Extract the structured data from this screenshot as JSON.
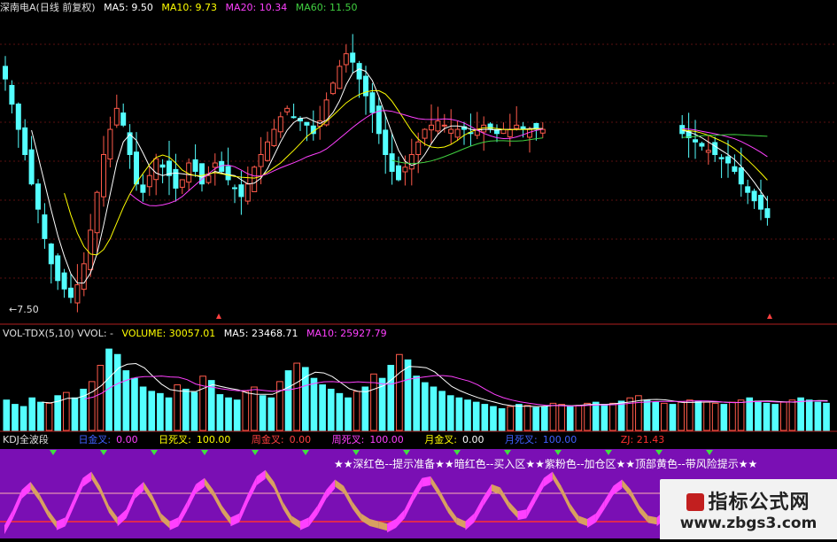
{
  "price_panel": {
    "title": "深南电A(日线 前复权)",
    "ma5": "MA5: 9.50",
    "ma10": "MA10: 9.73",
    "ma20": "MA20: 10.34",
    "ma60": "MA60: 11.50",
    "low_marker": "←7.50"
  },
  "volume_panel": {
    "title": "VOL-TDX(5,10) VVOL: -",
    "volume": "VOLUME: 30057.01",
    "ma5": "MA5: 23468.71",
    "ma10": "MA10: 25927.79"
  },
  "kdj_panel": {
    "title": "KDJ全波段",
    "items": [
      {
        "label": "日金叉:",
        "value": "0.00"
      },
      {
        "label": "日死叉:",
        "value": "100.00"
      },
      {
        "label": "周金叉:",
        "value": "0.00"
      },
      {
        "label": "周死叉:",
        "value": "100.00"
      },
      {
        "label": "月金叉:",
        "value": "0.00"
      },
      {
        "label": "月死叉:",
        "value": "100.00"
      }
    ],
    "zj": "ZJ: 21.43",
    "note": "★★深红色--提示准备★★暗红色--买入区★★紫粉色--加仓区★★顶部黄色--带风险提示★★"
  },
  "watermark": {
    "title": "指标公式网",
    "url": "www.zbgs3.com"
  },
  "colors": {
    "up": "#ff5a4a",
    "down": "#54ffff",
    "ma5": "#ffffff",
    "ma10": "#ffff00",
    "ma20": "#ff40ff",
    "ma60": "#40d040",
    "kdj_bg": "#7a0fb4",
    "pink": "#ff40ff",
    "tan": "#d8a060",
    "axis": "#b02020"
  },
  "chart_data": [
    {
      "type": "candlestick",
      "title": "深南电A(日线 前复权)",
      "series_names": [
        "MA5",
        "MA10",
        "MA20",
        "MA60"
      ],
      "min_price_label": "7.50",
      "close": [
        12.8,
        12.2,
        11.6,
        11.0,
        10.3,
        9.7,
        9.0,
        8.4,
        8.0,
        7.8,
        7.6,
        7.9,
        8.4,
        9.2,
        10.1,
        11.0,
        11.6,
        12.1,
        11.7,
        11.0,
        10.3,
        10.1,
        10.5,
        10.9,
        10.7,
        10.5,
        10.2,
        10.4,
        10.8,
        10.6,
        10.3,
        10.5,
        10.8,
        10.6,
        10.4,
        10.2,
        10.0,
        10.3,
        10.7,
        11.0,
        11.3,
        11.6,
        11.9,
        12.1,
        11.9,
        11.8,
        11.7,
        11.5,
        11.8,
        12.3,
        12.7,
        13.1,
        13.4,
        13.2,
        12.8,
        12.4,
        12.0,
        11.5,
        11.0,
        10.6,
        10.4,
        10.7,
        11.0,
        11.3,
        11.6,
        11.7,
        11.8,
        11.7,
        11.6,
        11.6,
        11.6,
        11.5,
        11.6,
        11.7,
        11.6,
        11.5,
        11.6,
        11.6,
        11.7,
        11.6,
        11.6,
        11.6,
        11.6,
        11.5,
        11.4,
        11.3,
        11.2,
        11.1,
        11.0,
        10.9,
        10.8,
        10.6,
        10.3,
        10.1,
        9.9,
        9.7,
        9.5
      ],
      "gap_after_index": 82
    },
    {
      "type": "bar",
      "title": "VOL-TDX(5,10)",
      "series_names": [
        "VOLUME",
        "MA5",
        "MA10"
      ],
      "last_values": {
        "VOLUME": 30057.01,
        "MA5": 23468.71,
        "MA10": 25927.79
      },
      "values": [
        28,
        24,
        22,
        30,
        26,
        25,
        32,
        35,
        30,
        38,
        45,
        60,
        75,
        70,
        55,
        48,
        40,
        36,
        34,
        30,
        42,
        38,
        35,
        50,
        46,
        33,
        30,
        28,
        36,
        40,
        32,
        30,
        45,
        55,
        62,
        58,
        48,
        42,
        38,
        34,
        30,
        36,
        40,
        52,
        48,
        60,
        70,
        65,
        50,
        44,
        40,
        36,
        32,
        30,
        28,
        26,
        24,
        22,
        20,
        22,
        24,
        23,
        21,
        22,
        25,
        24,
        22,
        23,
        25,
        26,
        24,
        25,
        27,
        30,
        32,
        28,
        26,
        25,
        24,
        26,
        28,
        27,
        26,
        25,
        24,
        26,
        28,
        30,
        27,
        25,
        24,
        26,
        28,
        30,
        28,
        26,
        25
      ]
    },
    {
      "type": "area",
      "title": "KDJ全波段",
      "values": [
        10,
        30,
        55,
        65,
        50,
        30,
        15,
        20,
        45,
        70,
        78,
        60,
        35,
        20,
        30,
        55,
        65,
        48,
        25,
        15,
        20,
        40,
        62,
        70,
        55,
        35,
        20,
        25,
        50,
        72,
        80,
        65,
        40,
        22,
        15,
        20,
        35,
        55,
        68,
        60,
        40,
        25,
        18,
        15,
        12,
        18,
        30,
        52,
        70,
        72,
        55,
        35,
        20,
        15,
        25,
        45,
        62,
        58,
        40,
        28,
        30,
        50,
        70,
        78,
        60,
        38,
        22,
        18,
        25,
        42,
        60,
        68,
        55,
        35,
        22,
        20,
        30,
        45,
        55,
        50,
        40,
        30,
        25,
        28,
        35
      ]
    }
  ]
}
